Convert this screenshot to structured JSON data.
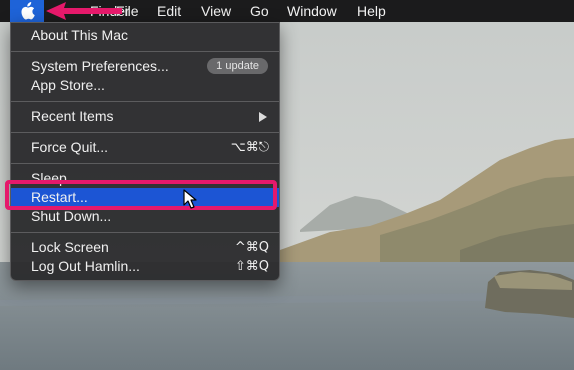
{
  "menubar": {
    "items": [
      "Finder",
      "File",
      "Edit",
      "View",
      "Go",
      "Window",
      "Help"
    ]
  },
  "apple_menu": {
    "about": "About This Mac",
    "system_preferences": "System Preferences...",
    "update_badge": "1 update",
    "app_store": "App Store...",
    "recent_items": "Recent Items",
    "force_quit": "Force Quit...",
    "force_quit_shortcut": "⌥⌘⎋",
    "sleep": "Sleep",
    "restart": "Restart...",
    "shut_down": "Shut Down...",
    "lock_screen": "Lock Screen",
    "lock_screen_shortcut": "^⌘Q",
    "log_out": "Log Out Hamlin...",
    "log_out_shortcut": "⇧⌘Q"
  },
  "colors": {
    "highlight": "#1c55d4",
    "annotation": "#e5196b",
    "menubar": "#1b1b1c"
  }
}
